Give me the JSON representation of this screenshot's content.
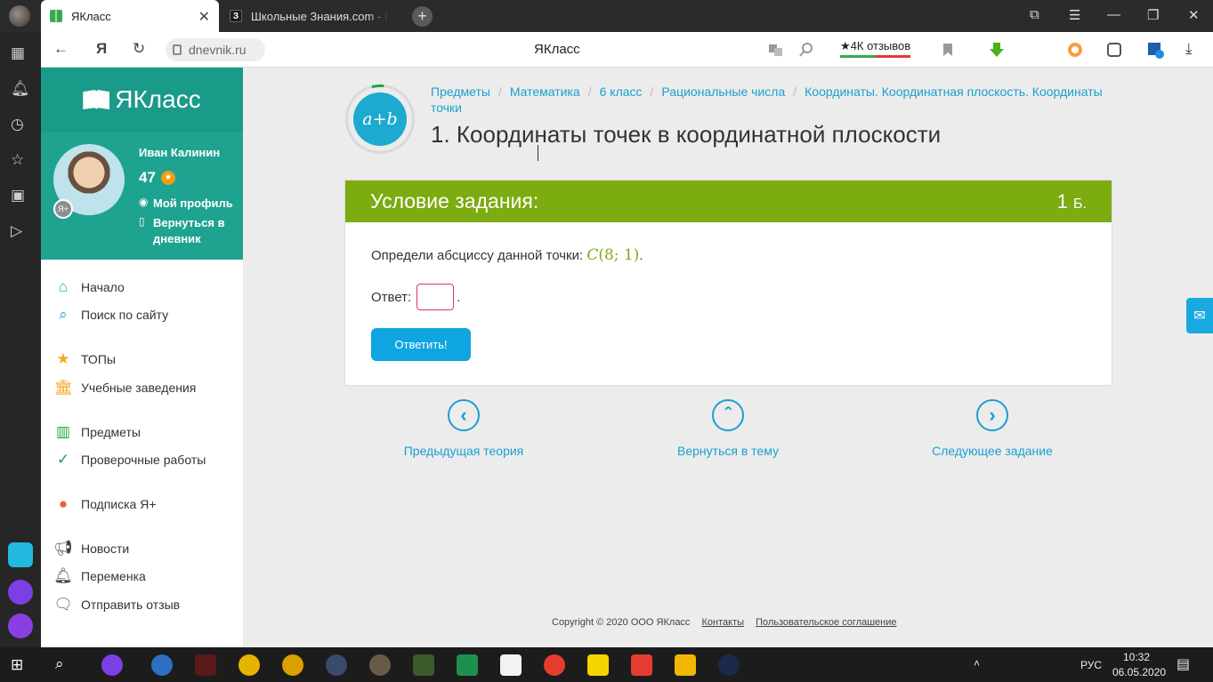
{
  "browser": {
    "tabs": [
      {
        "title": "ЯКласс",
        "favicon": "yaklass-favicon"
      },
      {
        "title": "Школьные Знания.com - П",
        "favicon": "znanija-favicon",
        "favicon_text": "З"
      }
    ],
    "new_tab": "+",
    "window_controls": {
      "stack": "⧉",
      "menu": "☰",
      "minimize": "—",
      "restore": "❐",
      "close": "✕"
    },
    "address": "dnevnik.ru",
    "page_title": "ЯКласс",
    "reviews": "★4К отзывов"
  },
  "site": {
    "logo": "ЯКласс",
    "user": {
      "name": "Иван Калинин",
      "points": "47",
      "badge": "Я+",
      "profile_link": "Мой профиль",
      "diary_link": "Вернуться в дневник"
    },
    "nav": [
      {
        "label": "Начало",
        "icon": "home-icon"
      },
      {
        "label": "Поиск по сайту",
        "icon": "search-icon"
      },
      {
        "label": "ТОПы",
        "icon": "star-icon"
      },
      {
        "label": "Учебные заведения",
        "icon": "school-icon"
      },
      {
        "label": "Предметы",
        "icon": "books-icon"
      },
      {
        "label": "Проверочные работы",
        "icon": "check-icon"
      },
      {
        "label": "Подписка Я+",
        "icon": "subscription-icon"
      },
      {
        "label": "Новости",
        "icon": "megaphone-icon"
      },
      {
        "label": "Переменка",
        "icon": "bell-icon"
      },
      {
        "label": "Отправить отзыв",
        "icon": "feedback-icon"
      }
    ]
  },
  "breadcrumbs": [
    "Предметы",
    "Математика",
    "6 класс",
    "Рациональные числа",
    "Координаты. Координатная плоскость. Координаты точки"
  ],
  "topic_badge": "a+b",
  "page_heading": "1. Координаты точек в координатной плоскости",
  "task": {
    "header": "Условие задания:",
    "points": "1",
    "points_unit": "Б.",
    "question": "Определи абсциссу данной точки:",
    "math_point": "C",
    "math_coords": "(8; 1)",
    "question_end": ".",
    "answer_label": "Ответ:",
    "answer_value": "",
    "answer_end": ".",
    "submit": "Ответить!"
  },
  "bottom_nav": {
    "prev": "Предыдущая теория",
    "back": "Вернуться в тему",
    "next": "Следующее задание"
  },
  "footer": {
    "copyright": "Copyright © 2020 ООО ЯКласс",
    "contacts": "Контакты",
    "agreement": "Пользовательское соглашение"
  },
  "taskbar": {
    "tray_language": "РУС",
    "time": "10:32",
    "date": "06.05.2020"
  },
  "colors": {
    "brand_teal": "#1fa391",
    "task_green": "#7cac10",
    "link_blue": "#1a9fd0",
    "button_blue": "#0ea5e0"
  }
}
